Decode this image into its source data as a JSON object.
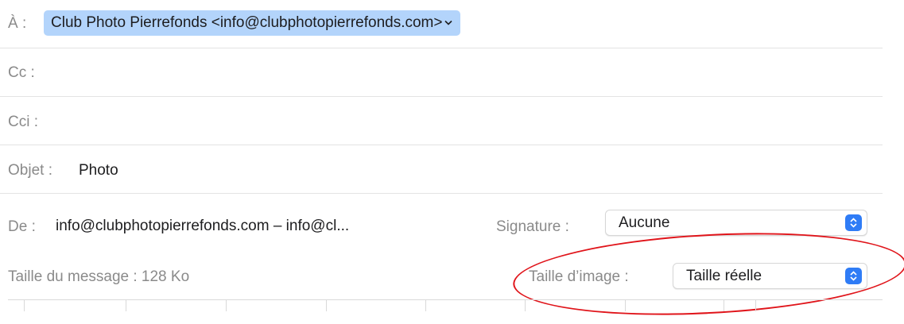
{
  "to": {
    "label": "À :",
    "recipient": "Club Photo Pierrefonds <info@clubphotopierrefonds.com>"
  },
  "cc": {
    "label": "Cc :"
  },
  "bcc": {
    "label": "Cci :"
  },
  "subject": {
    "label": "Objet :",
    "value": "Photo"
  },
  "from": {
    "label": "De :",
    "value": "info@clubphotopierrefonds.com – info@cl..."
  },
  "signature": {
    "label": "Signature :",
    "selected": "Aucune"
  },
  "message_size": {
    "label": "Taille du message : 128 Ko"
  },
  "image_size": {
    "label": "Taille d’image :",
    "selected": "Taille réelle"
  },
  "colors": {
    "token_bg": "#b3d4fb",
    "stepper": "#2f7cf6",
    "annotation": "#e0141a"
  },
  "icons": [
    "chevron-down-icon",
    "updown-stepper-icon"
  ]
}
